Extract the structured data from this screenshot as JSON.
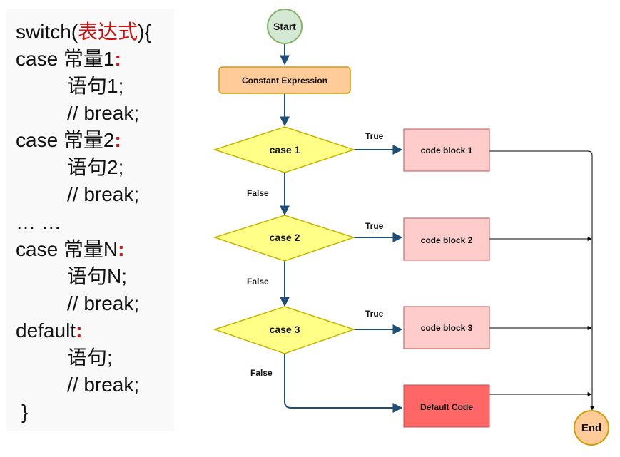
{
  "code": {
    "line1": {
      "pre": "switch(",
      "expr": "表达式",
      "post": "){"
    },
    "line2": {
      "text": "case 常量1",
      "colon": ":"
    },
    "line3": "语句1;",
    "line4": "// break;",
    "line5": {
      "text": "case 常量2",
      "colon": ":"
    },
    "line6": "语句2;",
    "line7": "// break;",
    "line8": "… …",
    "line9": {
      "text": "case 常量N",
      "colon": ":"
    },
    "line10": "语句N;",
    "line11": "// break;",
    "line12": {
      "text": "default",
      "colon": ":"
    },
    "line13": "语句;",
    "line14": "// break;",
    "line15": "}"
  },
  "flowchart": {
    "start": "Start",
    "constant_expression": "Constant Expression",
    "cases": [
      "case 1",
      "case 2",
      "case 3"
    ],
    "blocks": [
      "code block 1",
      "code block 2",
      "code block 3"
    ],
    "default_block": "Default Code",
    "end": "End",
    "true_label": "True",
    "false_label": "False"
  },
  "colors": {
    "start_fill": "#d5e8d4",
    "start_stroke": "#82b366",
    "const_fill": "#ffcc99",
    "const_stroke": "#d79b00",
    "decision_fill": "#ffff88",
    "decision_stroke": "#c8b300",
    "block_fill": "#ffcccc",
    "block_stroke": "#b85450",
    "default_fill": "#ff6666",
    "end_fill": "#ffcc99",
    "end_stroke": "#d79b00",
    "main_arrow": "#1f4e79",
    "side_line": "#000000",
    "code_keyword_red": "#d01010"
  }
}
